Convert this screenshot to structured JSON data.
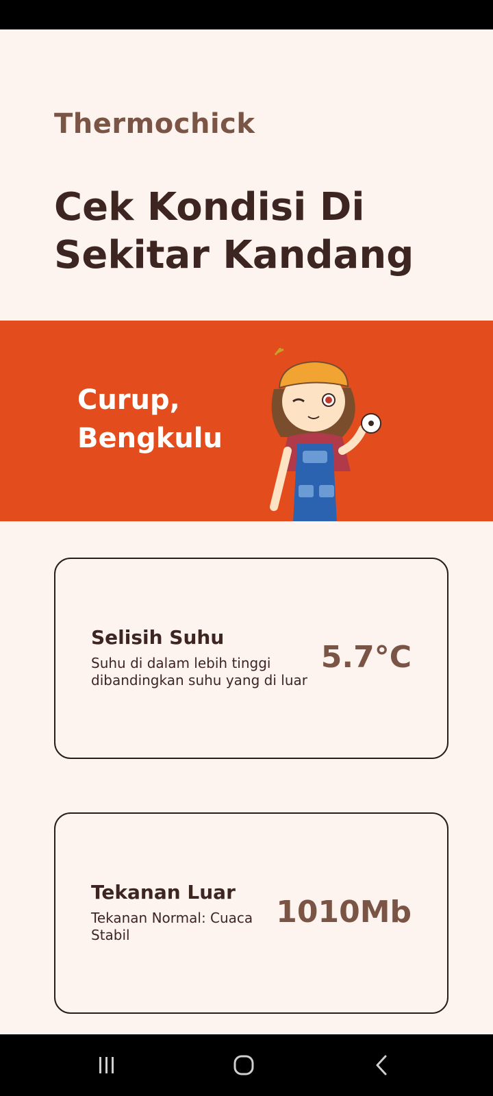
{
  "app": {
    "name": "Thermochick",
    "headline": "Cek Kondisi Di Sekitar Kandang"
  },
  "banner": {
    "location": "Curup, Bengkulu",
    "background_color": "#e34c1c"
  },
  "cards": [
    {
      "title": "Selisih Suhu",
      "description": "Suhu di dalam lebih tinggi dibandingkan suhu yang di luar",
      "value": "5.7°C"
    },
    {
      "title": "Tekanan Luar",
      "description": "Tekanan Normal: Cuaca Stabil",
      "value": "1010Mb"
    }
  ],
  "nav": {
    "icons": [
      "recents-icon",
      "home-icon",
      "back-icon"
    ]
  },
  "colors": {
    "accent": "#e34c1c",
    "brand_brown": "#7a5445",
    "text_dark": "#3d2621",
    "background": "#fdf3ef"
  }
}
